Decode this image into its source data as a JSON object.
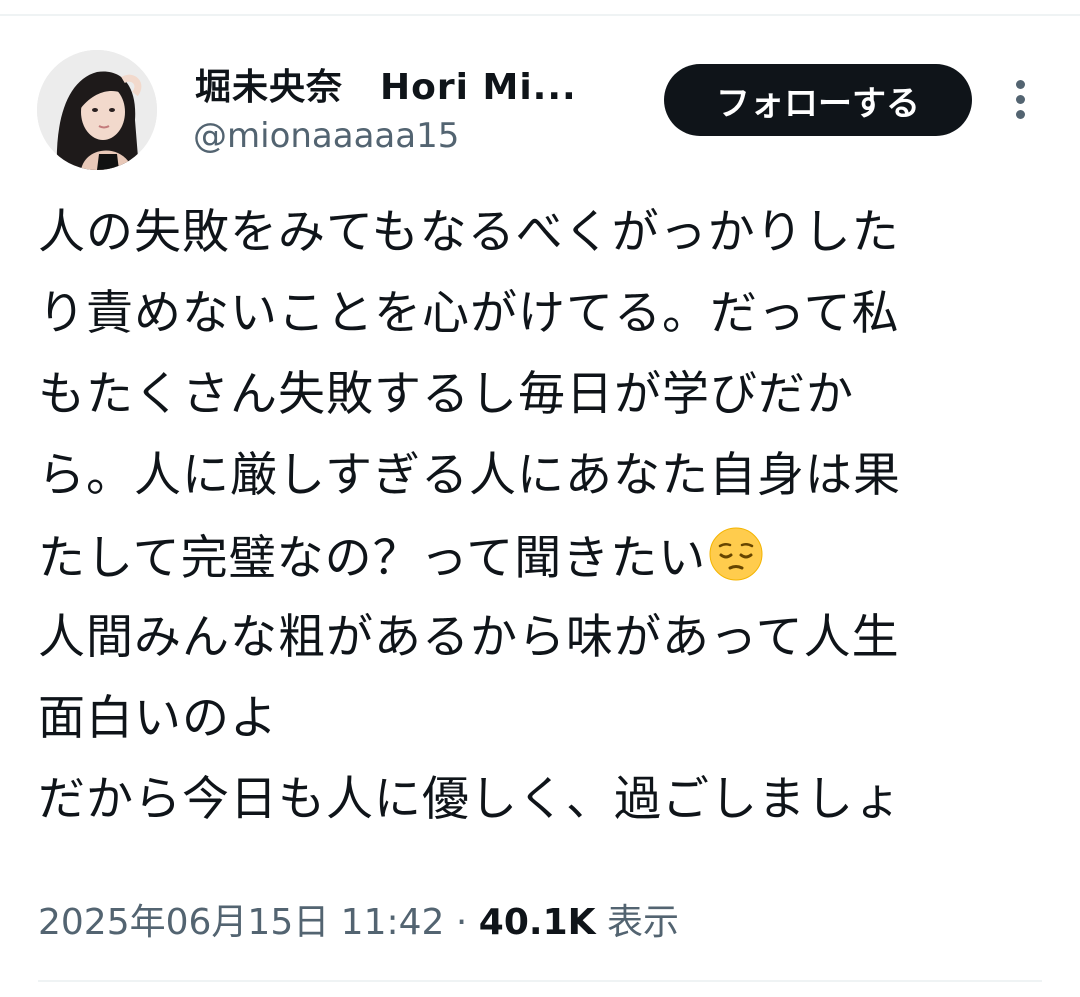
{
  "author": {
    "display_name": "堀未央奈　Hori Mi...",
    "handle": "@mionaaaaa15",
    "avatar_icon": "avatar-photo"
  },
  "follow_button": {
    "label": "フォローする"
  },
  "more_button": {
    "icon": "more-vertical-icon"
  },
  "tweet": {
    "lines": [
      "人の失敗をみてもなるべくがっかりした",
      "り責めないことを心がけてる。だって私",
      "もたくさん失敗するし毎日が学びだか",
      "ら。人に厳しすぎる人にあなた自身は果",
      "たして完璧なの？って聞きたい",
      "人間みんな粗があるから味があって人生",
      "面白いのよ",
      "だから今日も人に優しく、過ごしましょ"
    ],
    "emoji": "pensive-face-icon"
  },
  "meta": {
    "timestamp": "2025年06月15日 11:42",
    "separator": "·",
    "views_count": "40.1K",
    "views_label": "表示"
  },
  "colors": {
    "text": "#0f1419",
    "secondary": "#536471",
    "button_bg": "#0f1419",
    "divider": "#eff3f4"
  }
}
